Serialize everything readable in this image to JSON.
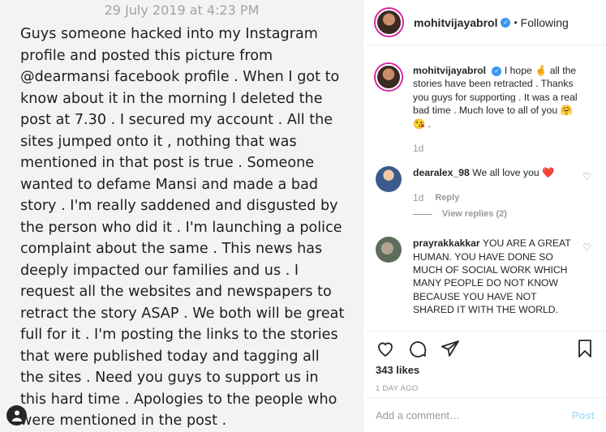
{
  "photo": {
    "date": "29 July 2019 at 4:23 PM",
    "text": "Guys someone hacked into my Instagram profile and posted this picture from @dearmansi facebook profile . When I got to know about it in the morning I deleted the post at 7.30 . I secured my account . All the sites jumped onto it , nothing that was mentioned in that post is true . Someone wanted to defame Mansi  and made a bad story . I'm really saddened and disgusted by the person who did it  . I'm launching a police complaint about the same . This news has deeply impacted our families and us  . I request all the websites and newspapers to retract the story ASAP . We both will be great full  for it . I'm posting the links to the stories that were published today and tagging all the sites . Need you guys to support us in this hard time . Apologies to the people who were mentioned in the post ."
  },
  "header": {
    "username": "mohitvijayabrol",
    "separator": "•",
    "follow_status": "Following"
  },
  "caption": {
    "username": "mohitvijayabrol",
    "text": "I hope 🤞 all the stories have been retracted . Thanks you guys for supporting . It was a real bad time . Much love to all of you 🤗 😘 .",
    "time": "1d"
  },
  "comments": [
    {
      "username": "dearalex_98",
      "text": "We all love you ❤️",
      "time": "1d",
      "reply": "Reply",
      "view_replies": "View replies (2)"
    },
    {
      "username": "prayrakkakkar",
      "text": "YOU ARE A GREAT HUMAN. YOU HAVE DONE SO MUCH OF SOCIAL WORK WHICH MANY PEOPLE DO NOT KNOW BECAUSE YOU HAVE NOT SHARED IT WITH THE WORLD."
    }
  ],
  "actions": {
    "likes": "343 likes",
    "time_ago": "1 DAY AGO"
  },
  "add_comment": {
    "placeholder": "Add a comment…",
    "post_label": "Post"
  },
  "colors": {
    "verified": "#3897f0",
    "like_red": "#ed4956",
    "post_disabled": "#b2dffc"
  },
  "icons": [
    "heart-icon",
    "comment-icon",
    "share-icon",
    "bookmark-icon",
    "verified-icon",
    "user-icon"
  ]
}
